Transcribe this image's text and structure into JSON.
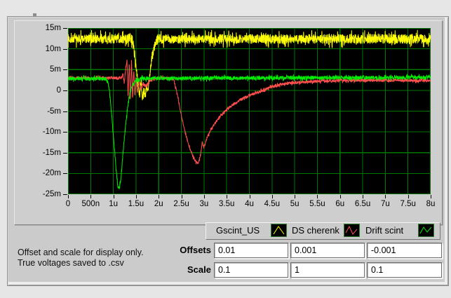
{
  "window": {
    "bg": "#e6e6e6",
    "panel_bg": "#cbcbcb"
  },
  "note": {
    "line1": "Offset and scale for display only.",
    "line2": "True voltages saved to .csv"
  },
  "controls": {
    "offsets_label": "Offsets",
    "scale_label": "Scale",
    "offsets": [
      "0.01",
      "0.001",
      "-0.001"
    ],
    "scale": [
      "0.1",
      "1",
      "0.1"
    ]
  },
  "chart_data": {
    "type": "line",
    "title": "",
    "xlabel": "",
    "ylabel": "",
    "bg": "#000000",
    "grid_color": "#007800",
    "grid": true,
    "legend_position": "bottom-right",
    "x_ticks": [
      "0",
      "500n",
      "1u",
      "1.5u",
      "2u",
      "2.5u",
      "3u",
      "3.5u",
      "4u",
      "4.5u",
      "5u",
      "5.5u",
      "6u",
      "6.5u",
      "7u",
      "7.5u",
      "8u"
    ],
    "y_ticks": [
      "15m",
      "10m",
      "5m",
      "0",
      "-5m",
      "-10m",
      "-15m",
      "-20m",
      "-25m"
    ],
    "xlim_us": [
      0,
      8
    ],
    "ylim_mv": [
      -25,
      15
    ],
    "series": [
      {
        "name": "Gscint_US",
        "color": "#ffff00",
        "noise_mv": 1.15,
        "keypoints_us_mv": [
          [
            0,
            12.4
          ],
          [
            1.42,
            12.4
          ],
          [
            1.5,
            6
          ],
          [
            1.54,
            1.5
          ],
          [
            1.58,
            -1
          ],
          [
            1.61,
            3
          ],
          [
            1.64,
            -2.2
          ],
          [
            1.67,
            0.5
          ],
          [
            1.7,
            -1.8
          ],
          [
            1.73,
            0.8
          ],
          [
            1.76,
            -0.5
          ],
          [
            1.8,
            3.5
          ],
          [
            1.86,
            8.5
          ],
          [
            1.93,
            11.5
          ],
          [
            1.99,
            12.4
          ],
          [
            8,
            12.4
          ]
        ]
      },
      {
        "name": "DS cherenk",
        "color": "#ff4f4f",
        "noise_mv": 0.35,
        "keypoints_us_mv": [
          [
            0,
            3
          ],
          [
            1.18,
            3
          ],
          [
            1.21,
            4
          ],
          [
            1.24,
            1.8
          ],
          [
            1.27,
            5.2
          ],
          [
            1.3,
            7.3
          ],
          [
            1.325,
            -1.5
          ],
          [
            1.35,
            6.8
          ],
          [
            1.375,
            -2.8
          ],
          [
            1.4,
            7
          ],
          [
            1.425,
            -2
          ],
          [
            1.45,
            5
          ],
          [
            1.475,
            -1.2
          ],
          [
            1.5,
            3.2
          ],
          [
            1.53,
            -0.5
          ],
          [
            1.57,
            2.2
          ],
          [
            1.61,
            0.2
          ],
          [
            1.66,
            1.8
          ],
          [
            1.72,
            0.8
          ],
          [
            1.8,
            2.4
          ],
          [
            1.95,
            2.9
          ],
          [
            2.15,
            3
          ],
          [
            2.33,
            2.7
          ],
          [
            2.42,
            -1.5
          ],
          [
            2.5,
            -6
          ],
          [
            2.58,
            -10
          ],
          [
            2.66,
            -13
          ],
          [
            2.74,
            -15.5
          ],
          [
            2.82,
            -17.2
          ],
          [
            2.87,
            -17.5
          ],
          [
            2.92,
            -15.8
          ],
          [
            2.96,
            -12.5
          ],
          [
            3,
            -13.8
          ],
          [
            3.05,
            -11.8
          ],
          [
            3.12,
            -10.2
          ],
          [
            3.22,
            -8.2
          ],
          [
            3.35,
            -6.3
          ],
          [
            3.5,
            -4.6
          ],
          [
            3.65,
            -3.3
          ],
          [
            3.82,
            -2.2
          ],
          [
            4,
            -1.3
          ],
          [
            4.2,
            -0.4
          ],
          [
            4.45,
            0.7
          ],
          [
            4.7,
            1.4
          ],
          [
            5,
            1.9
          ],
          [
            5.5,
            2.2
          ],
          [
            6,
            2.4
          ],
          [
            8,
            2.4
          ]
        ]
      },
      {
        "name": "Drift scint",
        "color": "#00ee00",
        "noise_mv": 0.45,
        "keypoints_us_mv": [
          [
            0,
            2.8
          ],
          [
            0.85,
            2.8
          ],
          [
            0.9,
            1
          ],
          [
            0.94,
            -3
          ],
          [
            0.98,
            -8
          ],
          [
            1.02,
            -13.5
          ],
          [
            1.06,
            -19
          ],
          [
            1.1,
            -23.2
          ],
          [
            1.13,
            -23.6
          ],
          [
            1.17,
            -21
          ],
          [
            1.21,
            -15.5
          ],
          [
            1.26,
            -9.5
          ],
          [
            1.31,
            -4.5
          ],
          [
            1.36,
            -1
          ],
          [
            1.42,
            1.2
          ],
          [
            1.5,
            2.4
          ],
          [
            1.65,
            2.9
          ],
          [
            8,
            3.1
          ]
        ]
      }
    ]
  }
}
